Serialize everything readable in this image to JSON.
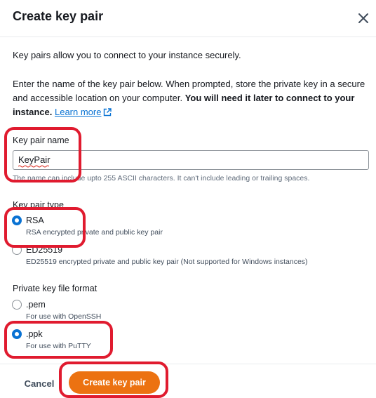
{
  "modal": {
    "title": "Create key pair",
    "close_icon": "close-icon"
  },
  "intro": "Key pairs allow you to connect to your instance securely.",
  "instructions": {
    "line1": "Enter the name of the key pair below. When prompted, store the private key in a secure",
    "line2_plain": "and accessible location on your computer. ",
    "line2_bold": "You will need it later to connect to your",
    "line3_bold": "instance.",
    "learn_more": "Learn more",
    "learn_more_icon": "external-link-icon"
  },
  "key_pair_name": {
    "label": "Key pair name",
    "value": "KeyPair",
    "hint": "The name can include upto 255 ASCII characters. It can't include leading or trailing spaces."
  },
  "key_pair_type": {
    "label": "Key pair type",
    "options": [
      {
        "label": "RSA",
        "description": "RSA encrypted private and public key pair",
        "selected": true
      },
      {
        "label": "ED25519",
        "description": "ED25519 encrypted private and public key pair (Not supported for Windows instances)",
        "selected": false
      }
    ]
  },
  "private_key_format": {
    "label": "Private key file format",
    "options": [
      {
        "label": ".pem",
        "description": "For use with OpenSSH",
        "selected": false
      },
      {
        "label": ".ppk",
        "description": "For use with PuTTY",
        "selected": true
      }
    ]
  },
  "footer": {
    "cancel_label": "Cancel",
    "create_label": "Create key pair"
  },
  "colors": {
    "primary_button": "#ec7211",
    "link": "#0972d3",
    "radio_selected": "#0972d3",
    "annotation_highlight": "#e01b2f"
  }
}
